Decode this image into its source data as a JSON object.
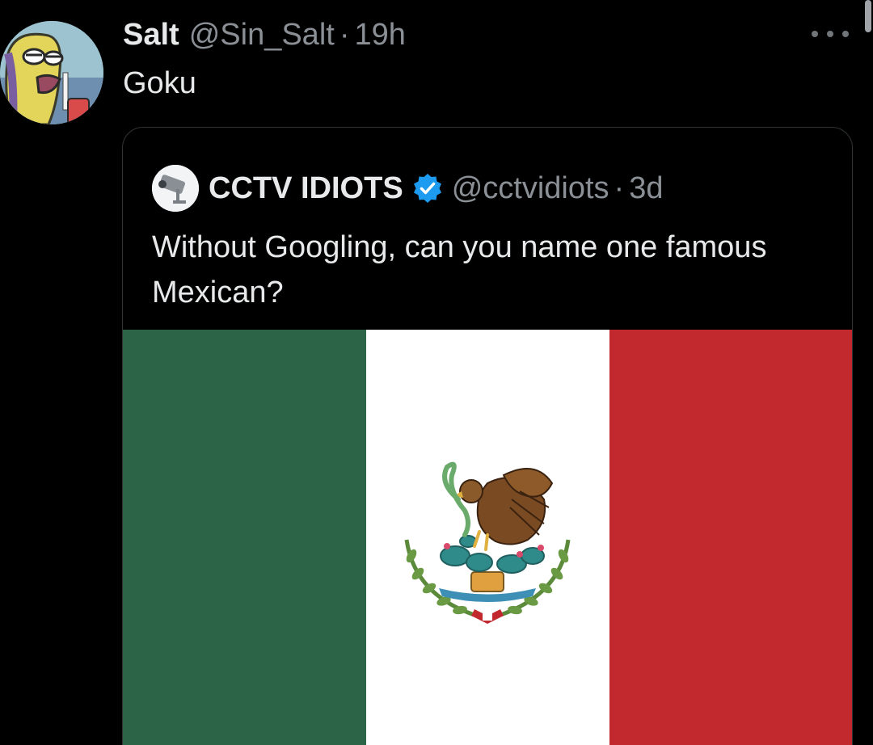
{
  "tweet": {
    "display_name": "Salt",
    "handle": "@Sin_Salt",
    "separator": "·",
    "time": "19h",
    "text": "Goku"
  },
  "quoted_tweet": {
    "display_name": "CCTV IDIOTS",
    "verified": true,
    "handle": "@cctvidiots",
    "separator": "·",
    "time": "3d",
    "text": "Without Googling, can you name one famous Mexican?",
    "image": "mexican-flag"
  },
  "colors": {
    "background": "#000000",
    "primary_text": "#e7e9ea",
    "secondary_text": "#8b9096",
    "verified_blue": "#1d9bf0",
    "flag_green": "#2b6447",
    "flag_white": "#ffffff",
    "flag_red": "#c2292f"
  },
  "icons": {
    "more": "more-horizontal-icon",
    "verified": "verified-badge-icon"
  }
}
